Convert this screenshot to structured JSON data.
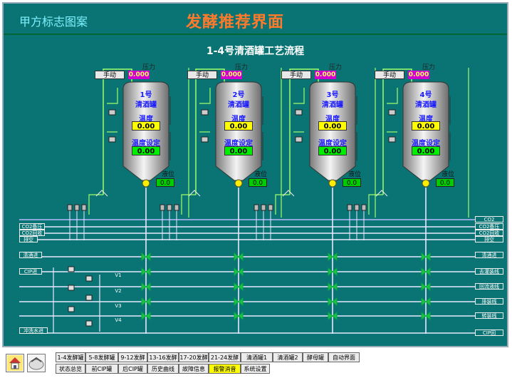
{
  "header": {
    "logo_text": "甲方标志图案",
    "title": "发酵推荐界面",
    "subtitle": "1-4号清酒罐工艺流程"
  },
  "tanks": [
    {
      "name_line1": "1号",
      "name_line2": "清酒罐",
      "mode": "手动",
      "pressure_label": "压力",
      "pressure": "0.000",
      "temp_label": "温度",
      "temp": "0.00",
      "temp_set_label": "温度设定",
      "temp_set": "0.00",
      "level_label": "液位",
      "level": "0.0"
    },
    {
      "name_line1": "2号",
      "name_line2": "清酒罐",
      "mode": "手动",
      "pressure_label": "压力",
      "pressure": "0.000",
      "temp_label": "温度",
      "temp": "0.00",
      "temp_set_label": "温度设定",
      "temp_set": "0.00",
      "level_label": "液位",
      "level": "0.0"
    },
    {
      "name_line1": "3号",
      "name_line2": "清酒罐",
      "mode": "手动",
      "pressure_label": "压力",
      "pressure": "0.000",
      "temp_label": "温度",
      "temp": "0.00",
      "temp_set_label": "温度设定",
      "temp_set": "0.00",
      "level_label": "液位",
      "level": "0.0"
    },
    {
      "name_line1": "4号",
      "name_line2": "清酒罐",
      "mode": "手动",
      "pressure_label": "压力",
      "pressure": "0.000",
      "temp_label": "温度",
      "temp": "0.00",
      "temp_set_label": "温度设定",
      "temp_set": "0.00",
      "level_label": "液位",
      "level": "0.0"
    }
  ],
  "pipes": {
    "left": [
      "CO2备压",
      "CO2回收",
      "排空",
      "清酒进",
      "CIP进",
      "冲洗水进"
    ],
    "right": [
      "CO2",
      "CO2备压",
      "CO2回收",
      "排空",
      "清酒进",
      "去灌装线",
      "回流液线",
      "排装线",
      "转装线",
      "CIP回"
    ],
    "valve_tags": [
      "V1",
      "V2",
      "V3",
      "V4"
    ]
  },
  "nav": {
    "row1": [
      "1-4发酵罐",
      "5-8发酵罐",
      "9-12发酵",
      "13-16发酵",
      "17-20发酵",
      "21-24发酵",
      "清酒罐1",
      "清酒罐2",
      "酵母罐",
      "自动界面"
    ],
    "row2": [
      "状态总览",
      "前CIP罐",
      "后CIP罐",
      "历史曲线",
      "故障信息",
      "报警消音",
      "系统设置"
    ],
    "active_row2_index": 5
  },
  "colors": {
    "background": "#0a7474",
    "pipe_white": "#e8e8ff",
    "pipe_green": "#9fff6a",
    "tank_body": "#c8c8c8",
    "title": "#ff7a2a"
  }
}
